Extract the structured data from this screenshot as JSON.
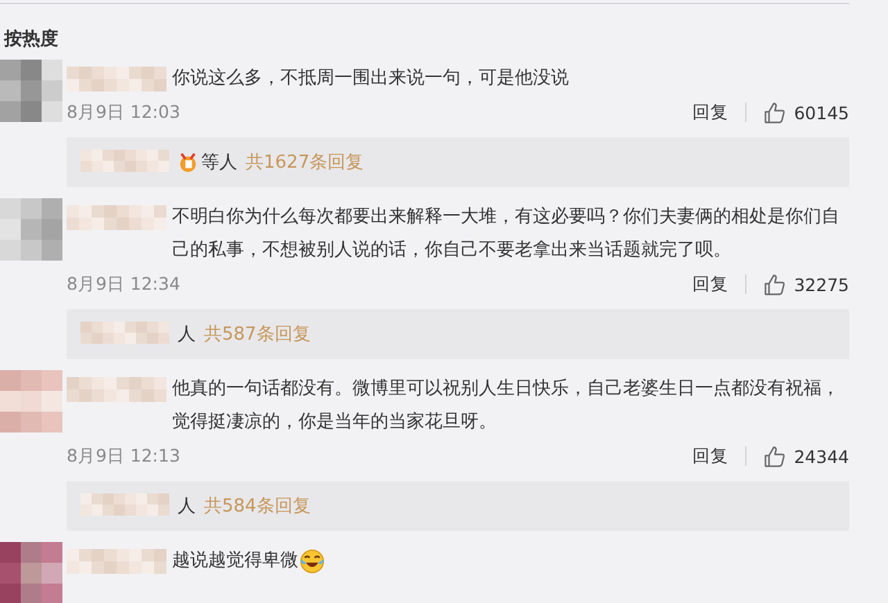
{
  "sort_tabs": [
    {
      "label": "按热度",
      "selected": true
    }
  ],
  "comments": [
    {
      "text": "你说这么多，不抵周一围出来说一句，可是他没说",
      "emoji": false,
      "date": "8月9日 12:03",
      "reply_label": "回复",
      "likes": "60145",
      "thread": {
        "badge": true,
        "suffix": "等人",
        "count": "共1627条回复"
      }
    },
    {
      "text": "不明白你为什么每次都要出来解释一大堆，有这必要吗？你们夫妻俩的相处是你们自己的私事，不想被别人说的话，你自己不要老拿出来当话题就完了呗。",
      "emoji": false,
      "date": "8月9日 12:34",
      "reply_label": "回复",
      "likes": "32275",
      "thread": {
        "badge": false,
        "suffix": "人",
        "count": "共587条回复"
      }
    },
    {
      "text": "他真的一句话都没有。微博里可以祝别人生日快乐，自己老婆生日一点都没有祝福，觉得挺凄凉的，你是当年的当家花旦呀。",
      "emoji": false,
      "date": "8月9日 12:13",
      "reply_label": "回复",
      "likes": "24344",
      "thread": {
        "badge": false,
        "suffix": "人",
        "count": "共584条回复"
      }
    },
    {
      "text": "越说越觉得卑微",
      "emoji": true
    }
  ]
}
